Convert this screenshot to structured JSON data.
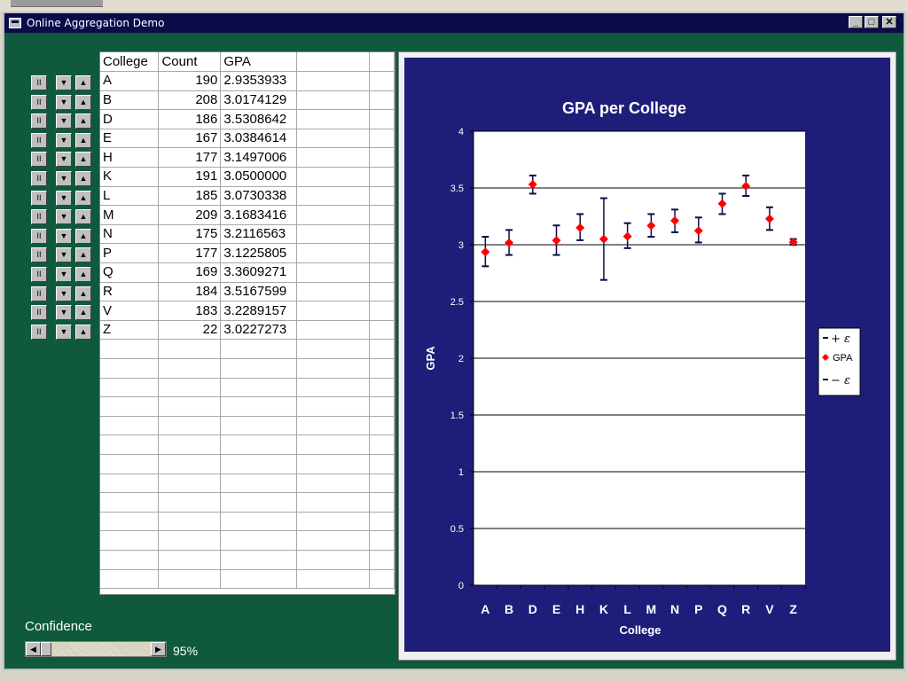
{
  "window": {
    "title": "Online Aggregation Demo",
    "buttons": {
      "minimize": "_",
      "maximize": "□",
      "close": "✕"
    }
  },
  "grid": {
    "headers": [
      "College",
      "Count",
      "GPA"
    ],
    "rows": [
      {
        "college": "A",
        "count": "190",
        "gpa": "2.9353933"
      },
      {
        "college": "B",
        "count": "208",
        "gpa": "3.0174129"
      },
      {
        "college": "D",
        "count": "186",
        "gpa": "3.5308642"
      },
      {
        "college": "E",
        "count": "167",
        "gpa": "3.0384614"
      },
      {
        "college": "H",
        "count": "177",
        "gpa": "3.1497006"
      },
      {
        "college": "K",
        "count": "191",
        "gpa": "3.0500000"
      },
      {
        "college": "L",
        "count": "185",
        "gpa": "3.0730338"
      },
      {
        "college": "M",
        "count": "209",
        "gpa": "3.1683416"
      },
      {
        "college": "N",
        "count": "175",
        "gpa": "3.2116563"
      },
      {
        "college": "P",
        "count": "177",
        "gpa": "3.1225805"
      },
      {
        "college": "Q",
        "count": "169",
        "gpa": "3.3609271"
      },
      {
        "college": "R",
        "count": "184",
        "gpa": "3.5167599"
      },
      {
        "college": "V",
        "count": "183",
        "gpa": "3.2289157"
      },
      {
        "college": "Z",
        "count": "22",
        "gpa": "3.0227273"
      }
    ]
  },
  "controls": {
    "icons": [
      "pause-icon",
      "arrow-down-icon",
      "arrow-up-icon"
    ],
    "pause_glyph": "II",
    "down_glyph": "▼",
    "up_glyph": "▲"
  },
  "confidence": {
    "label": "Confidence",
    "value_text": "95%",
    "level": 0.95,
    "left_arrow": "◀",
    "right_arrow": "▶"
  },
  "colors": {
    "window_bg": "#0f5a3c",
    "chart_bg": "#1e1e7a",
    "marker": "#ff0000",
    "error_bar": "#0b0b4a"
  },
  "chart_data": {
    "type": "scatter",
    "title": "GPA per College",
    "xlabel": "College",
    "ylabel": "GPA",
    "categories": [
      "A",
      "B",
      "D",
      "E",
      "H",
      "K",
      "L",
      "M",
      "N",
      "P",
      "Q",
      "R",
      "V",
      "Z"
    ],
    "ylim": [
      0,
      4
    ],
    "yticks": [
      "0",
      "0.5",
      "1",
      "1.5",
      "2",
      "2.5",
      "3",
      "3.5",
      "4"
    ],
    "grid": true,
    "legend_position": "right",
    "series": [
      {
        "name": "+ ε",
        "values": [
          3.07,
          3.13,
          3.61,
          3.17,
          3.27,
          3.41,
          3.19,
          3.27,
          3.31,
          3.24,
          3.45,
          3.61,
          3.33,
          3.05
        ]
      },
      {
        "name": "GPA",
        "values": [
          2.9353933,
          3.0174129,
          3.5308642,
          3.0384614,
          3.1497006,
          3.05,
          3.0730338,
          3.1683416,
          3.2116563,
          3.1225805,
          3.3609271,
          3.5167599,
          3.2289157,
          3.0227273
        ]
      },
      {
        "name": "− ε",
        "values": [
          2.81,
          2.91,
          3.45,
          2.91,
          3.04,
          2.69,
          2.97,
          3.07,
          3.11,
          3.02,
          3.27,
          3.43,
          3.13,
          3.0
        ]
      }
    ]
  }
}
